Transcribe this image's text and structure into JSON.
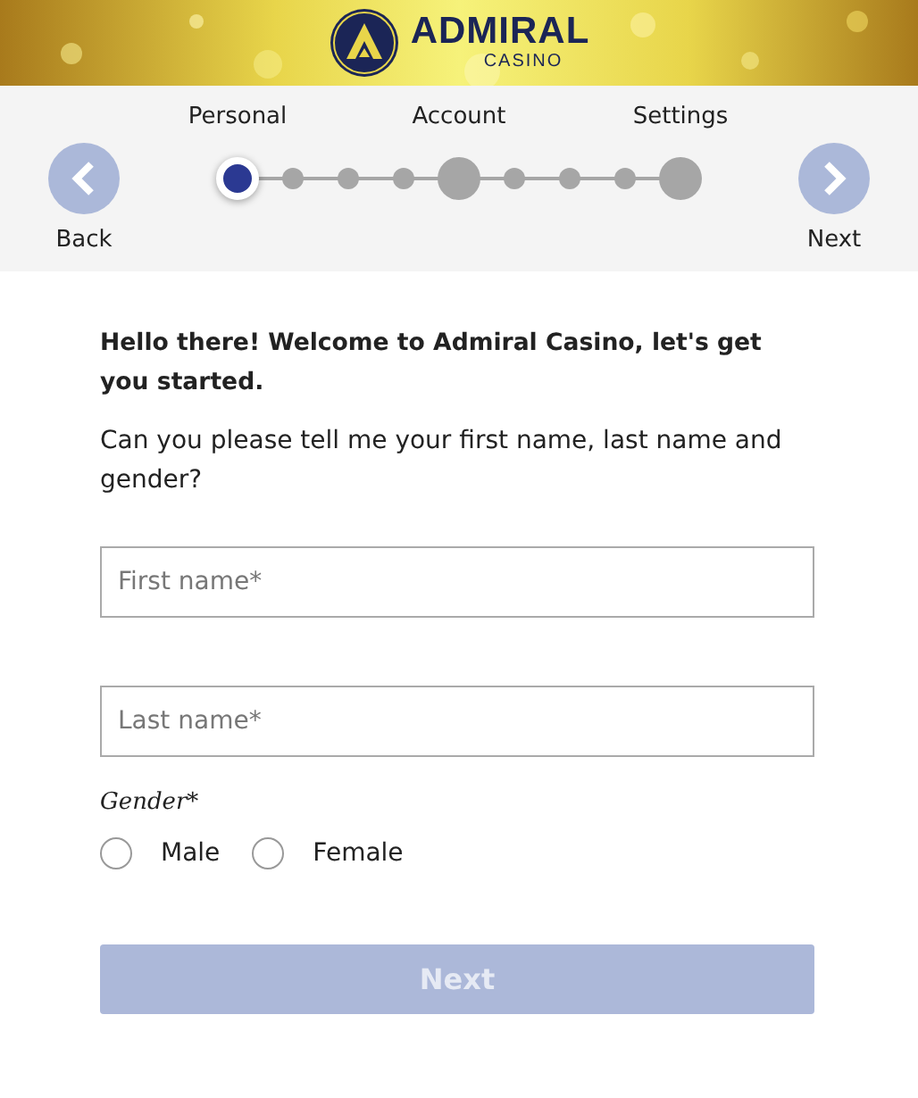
{
  "header": {
    "logo": {
      "name": "ADMIRAL",
      "subtitle": "CASINO"
    }
  },
  "stepper": {
    "back": "Back",
    "next": "Next",
    "steps": [
      {
        "kind": "major",
        "label": "Personal",
        "selected": true
      },
      {
        "kind": "minor",
        "selected": false
      },
      {
        "kind": "minor",
        "selected": false
      },
      {
        "kind": "minor",
        "selected": false
      },
      {
        "kind": "major",
        "label": "Account",
        "selected": false
      },
      {
        "kind": "minor",
        "selected": false
      },
      {
        "kind": "minor",
        "selected": false
      },
      {
        "kind": "minor",
        "selected": false
      },
      {
        "kind": "major",
        "label": "Settings",
        "selected": false
      }
    ]
  },
  "form": {
    "greeting": "Hello there! Welcome to Admiral Casino, let's get you started.",
    "question": "Can you please tell me your first name, last name and gender?",
    "fields": [
      {
        "placeholder": "First name*"
      },
      {
        "placeholder": "Last name*"
      }
    ],
    "gender_label": "Gender*",
    "options": [
      {
        "label": "Male",
        "selected": false
      },
      {
        "label": "Female",
        "selected": false
      }
    ],
    "submit": {
      "label": "Next",
      "disabled": true
    }
  }
}
